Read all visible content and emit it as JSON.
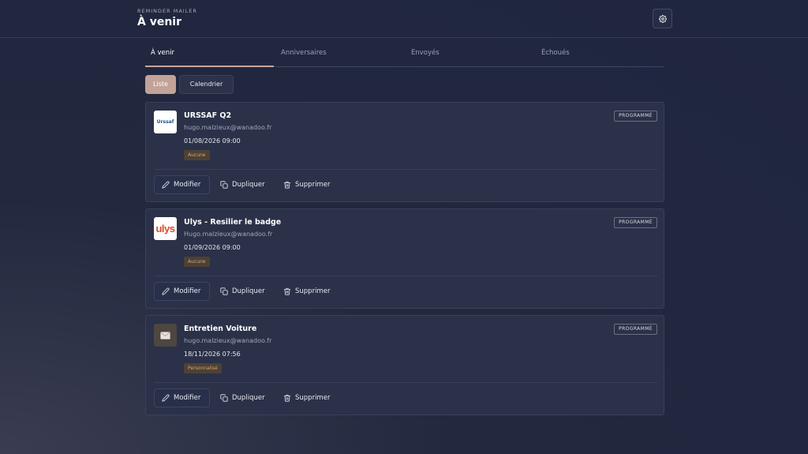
{
  "header": {
    "app_name": "REMINDER MAILER",
    "title": "À venir",
    "settings_icon": "gear-icon"
  },
  "tabs": [
    {
      "label": "À venir",
      "active": true
    },
    {
      "label": "Anniversaires",
      "active": false
    },
    {
      "label": "Envoyés",
      "active": false
    },
    {
      "label": "Échoués",
      "active": false
    }
  ],
  "view_toggle": {
    "list_label": "Liste",
    "calendar_label": "Calendrier",
    "selected": "Liste"
  },
  "reminders": [
    {
      "logo_text": "Urssaf",
      "logo_icon": "urssaf-logo",
      "title": "URSSAF Q2",
      "email": "hugo.malzieux@wanadoo.fr",
      "datetime": "01/08/2026 09:00",
      "tag": "Aucune",
      "status": "PROGRAMMÉ"
    },
    {
      "logo_text": "ulys",
      "logo_icon": "ulys-logo",
      "title": "Ulys - Resilier le badge",
      "email": "Hugo.malzieux@wanadoo.fr",
      "datetime": "01/09/2026 09:00",
      "tag": "Aucune",
      "status": "PROGRAMMÉ"
    },
    {
      "logo_text": "",
      "logo_icon": "envelope-icon",
      "title": "Entretien Voiture",
      "email": "hugo.malzieux@wanadoo.fr",
      "datetime": "18/11/2026 07:56",
      "tag": "Personnalisé",
      "status": "PROGRAMMÉ"
    }
  ],
  "actions": {
    "modify": "Modifier",
    "duplicate": "Dupliquer",
    "delete": "Supprimer"
  },
  "colors": {
    "accent": "#c3a298",
    "background": "#22283e",
    "card": "#2b3148",
    "tag_bg": "#4e4134",
    "tag_text": "#cda57e"
  }
}
